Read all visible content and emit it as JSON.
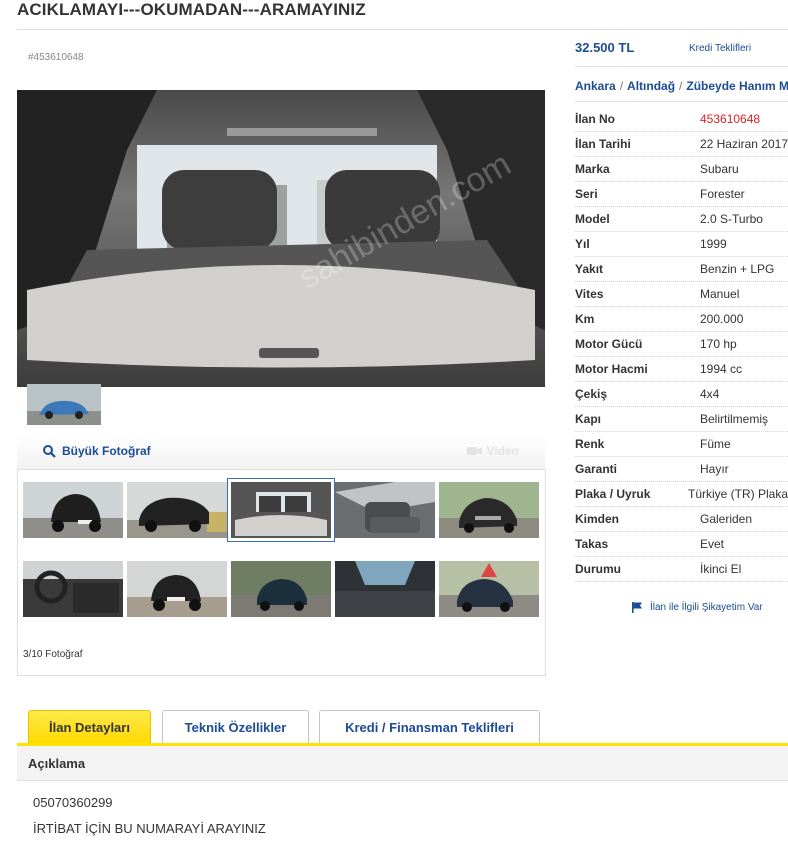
{
  "title": "ACIKLAMAYI---OKUMADAN---ARAMAYINIZ",
  "listing_number_small": "#453610648",
  "gallery": {
    "big_photo_label": "Büyük Fotoğraf",
    "video_label": "Video",
    "photo_count": "3/10 Fotoğraf",
    "selected_index": 3
  },
  "price": "32.500 TL",
  "credit_link": "Kredi Teklifleri",
  "breadcrumb": [
    "Ankara",
    "Altındağ",
    "Zübeyde Hanım M"
  ],
  "details": [
    {
      "label": "İlan No",
      "value": "453610648"
    },
    {
      "label": "İlan Tarihi",
      "value": "22 Haziran 2017"
    },
    {
      "label": "Marka",
      "value": "Subaru"
    },
    {
      "label": "Seri",
      "value": "Forester"
    },
    {
      "label": "Model",
      "value": "2.0 S-Turbo"
    },
    {
      "label": "Yıl",
      "value": "1999"
    },
    {
      "label": "Yakıt",
      "value": "Benzin + LPG"
    },
    {
      "label": "Vites",
      "value": "Manuel"
    },
    {
      "label": "Km",
      "value": "200.000"
    },
    {
      "label": "Motor Gücü",
      "value": "170 hp"
    },
    {
      "label": "Motor Hacmi",
      "value": "1994 cc"
    },
    {
      "label": "Çekiş",
      "value": "4x4"
    },
    {
      "label": "Kapı",
      "value": "Belirtilmemiş"
    },
    {
      "label": "Renk",
      "value": "Füme"
    },
    {
      "label": "Garanti",
      "value": "Hayır"
    },
    {
      "label": "Plaka / Uyruk",
      "value": "Türkiye (TR) Plaka"
    },
    {
      "label": "Kimden",
      "value": "Galeriden"
    },
    {
      "label": "Takas",
      "value": "Evet"
    },
    {
      "label": "Durumu",
      "value": "İkinci El"
    }
  ],
  "complaint_link": "İlan ile İlgili Şikayetim Var",
  "tabs": [
    "İlan Detayları",
    "Teknik Özellikler",
    "Kredi / Finansman Teklifleri"
  ],
  "description": {
    "heading": "Açıklama",
    "lines": [
      "05070360299",
      "İRTİBAT İÇİN BU NUMARAYİ ARAYINIZ"
    ]
  },
  "colors": {
    "link_blue": "#1b4c95",
    "accent_yellow": "#ffe300",
    "listing_no_red": "#d22222"
  }
}
